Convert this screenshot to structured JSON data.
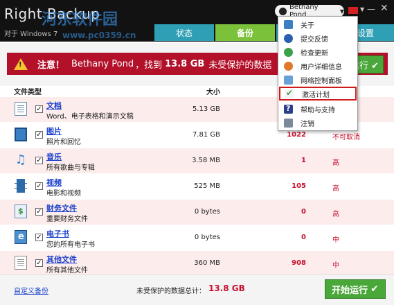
{
  "app": {
    "title": "Right Backup",
    "subtitle": "对于 Windows 7",
    "watermark": "河东软件园",
    "watermark_url": "www.pc0359.cn"
  },
  "header": {
    "user_name": "Bethany Pond",
    "tabs": [
      {
        "label": "状态"
      },
      {
        "label": "备份"
      },
      {
        "label": ""
      },
      {
        "label": "设置"
      }
    ]
  },
  "user_menu": {
    "items": [
      {
        "label": "关于",
        "icon": "info-icon"
      },
      {
        "label": "提交反馈",
        "icon": "feedback-icon"
      },
      {
        "label": "检查更新",
        "icon": "update-icon"
      },
      {
        "label": "用户详细信息",
        "icon": "user-icon"
      },
      {
        "label": "网络控制面板",
        "icon": "web-panel-icon"
      },
      {
        "label": "激活计划",
        "icon": "activate-icon",
        "highlighted": true
      },
      {
        "label": "帮助与支持",
        "icon": "help-icon"
      },
      {
        "label": "注销",
        "icon": "logout-icon"
      }
    ]
  },
  "alert": {
    "label": "注意！",
    "user": "Bethany Pond",
    "sep": "，找到",
    "size": "13.8 GB",
    "tail": "未受保护的数据",
    "run_label": "运行 ✔"
  },
  "table": {
    "headers": {
      "type": "文件类型",
      "size": "大小"
    },
    "rows": [
      {
        "title": "文档",
        "desc": "Word、电子表格和演示文稿",
        "size": "5.13 GB",
        "count": "",
        "priority": "",
        "icon": "document-icon",
        "checked": true
      },
      {
        "title": "图片",
        "desc": "照片和回忆",
        "size": "7.81 GB",
        "count": "1022",
        "priority": "不可取消",
        "icon": "picture-icon",
        "checked": true
      },
      {
        "title": "音乐",
        "desc": "所有歌曲与专辑",
        "size": "3.58 MB",
        "count": "1",
        "priority": "高",
        "icon": "music-icon",
        "checked": true
      },
      {
        "title": "视频",
        "desc": "电影和视频",
        "size": "525 MB",
        "count": "105",
        "priority": "高",
        "icon": "video-icon",
        "checked": true
      },
      {
        "title": "财务文件",
        "desc": "重要财务文件",
        "size": "0 bytes",
        "count": "0",
        "priority": "高",
        "icon": "finance-icon",
        "checked": true
      },
      {
        "title": "电子书",
        "desc": "您的所有电子书",
        "size": "0 bytes",
        "count": "0",
        "priority": "中",
        "icon": "ebook-icon",
        "checked": true
      },
      {
        "title": "其他文件",
        "desc": "所有其他文件",
        "size": "360 MB",
        "count": "908",
        "priority": "中",
        "icon": "other-file-icon",
        "checked": true
      }
    ]
  },
  "footer": {
    "custom_backup": "自定义备份",
    "total_label": "未受保护的数据总计：",
    "total_value": "13.8 GB",
    "start_label": "开始运行"
  }
}
